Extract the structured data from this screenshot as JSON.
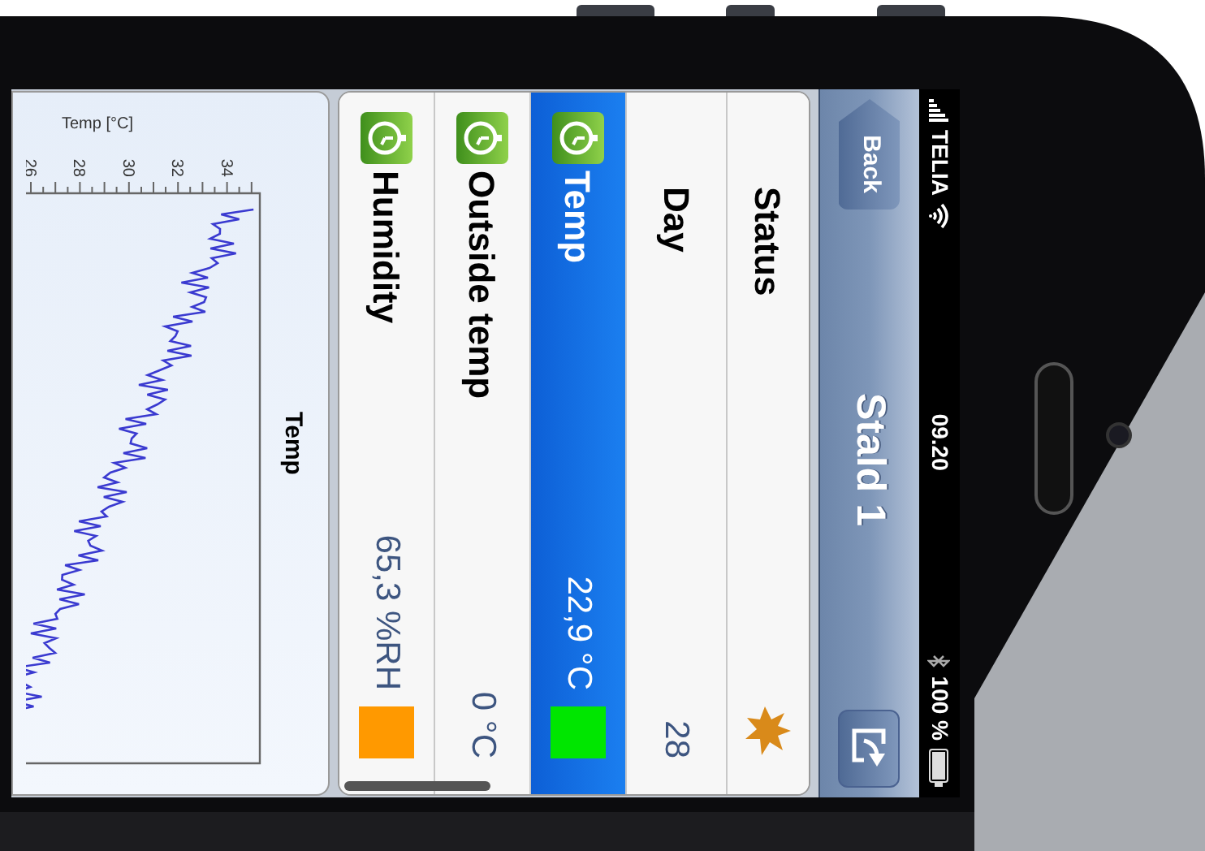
{
  "status_bar": {
    "carrier": "TELIA",
    "time": "09.20",
    "battery": "100 %"
  },
  "nav_bar": {
    "back": "Back",
    "title": "Stald 1"
  },
  "rows": [
    {
      "kind": "status",
      "label": "Status",
      "selected": false
    },
    {
      "kind": "value",
      "label": "Day",
      "value": "28",
      "selected": false
    },
    {
      "kind": "sensor",
      "label": "Temp",
      "value": "22,9 °C",
      "color": "#00e600",
      "selected": true
    },
    {
      "kind": "sensor",
      "label": "Outside temp",
      "value": "0 °C",
      "selected": false
    },
    {
      "kind": "sensor",
      "label": "Humidity",
      "value": "65,3 %RH",
      "color": "#ff9900",
      "selected": false
    }
  ],
  "chart": {
    "title": "Temp",
    "axis_title": "Temp [°C]",
    "tick_labels": [
      "26",
      "28",
      "30",
      "32",
      "34"
    ]
  }
}
